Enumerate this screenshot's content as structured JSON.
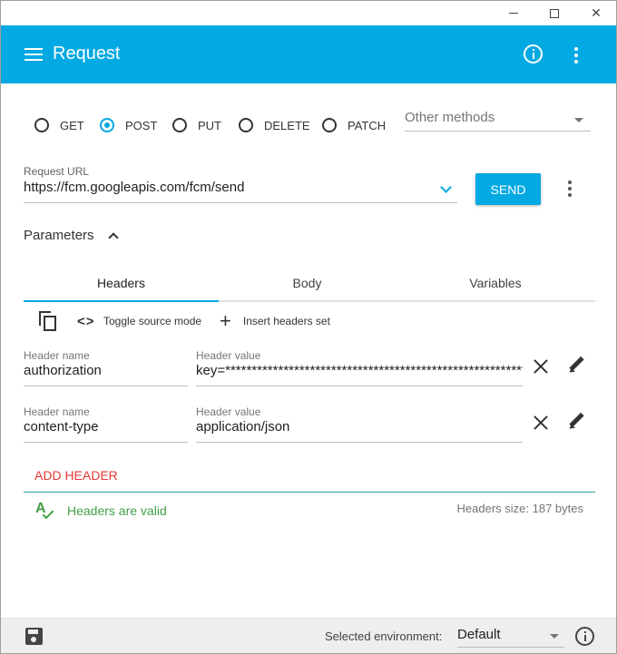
{
  "window": {
    "minimize": "—",
    "maximize": "□",
    "close": "✕"
  },
  "appbar": {
    "title": "Request",
    "menu_icon": "menu-icon",
    "info_icon": "info-icon",
    "more_icon": "more-vert-icon"
  },
  "methods": {
    "options": [
      {
        "label": "GET",
        "selected": false
      },
      {
        "label": "POST",
        "selected": true
      },
      {
        "label": "PUT",
        "selected": false
      },
      {
        "label": "DELETE",
        "selected": false
      },
      {
        "label": "PATCH",
        "selected": false
      }
    ],
    "other_placeholder": "Other methods"
  },
  "request": {
    "url_label": "Request URL",
    "url_value": "https://fcm.googleapis.com/fcm/send",
    "send_label": "SEND"
  },
  "parameters": {
    "label": "Parameters",
    "tabs": [
      "Headers",
      "Body",
      "Variables"
    ],
    "active_tab": "Headers"
  },
  "tools": {
    "toggle_source": "Toggle source mode",
    "insert_headers": "Insert headers set"
  },
  "headers": {
    "name_label": "Header name",
    "value_label": "Header value",
    "rows": [
      {
        "name": "authorization",
        "value": "key=************************************************************"
      },
      {
        "name": "content-type",
        "value": "application/json"
      }
    ],
    "add_label": "ADD HEADER",
    "valid_text": "Headers are valid",
    "size_text": "Headers size: 187 bytes"
  },
  "footer": {
    "env_label": "Selected environment:",
    "env_value": "Default"
  },
  "colors": {
    "accent": "#03a9e2",
    "add": "#e53935",
    "valid": "#43a047",
    "divider": "#26a69a"
  }
}
